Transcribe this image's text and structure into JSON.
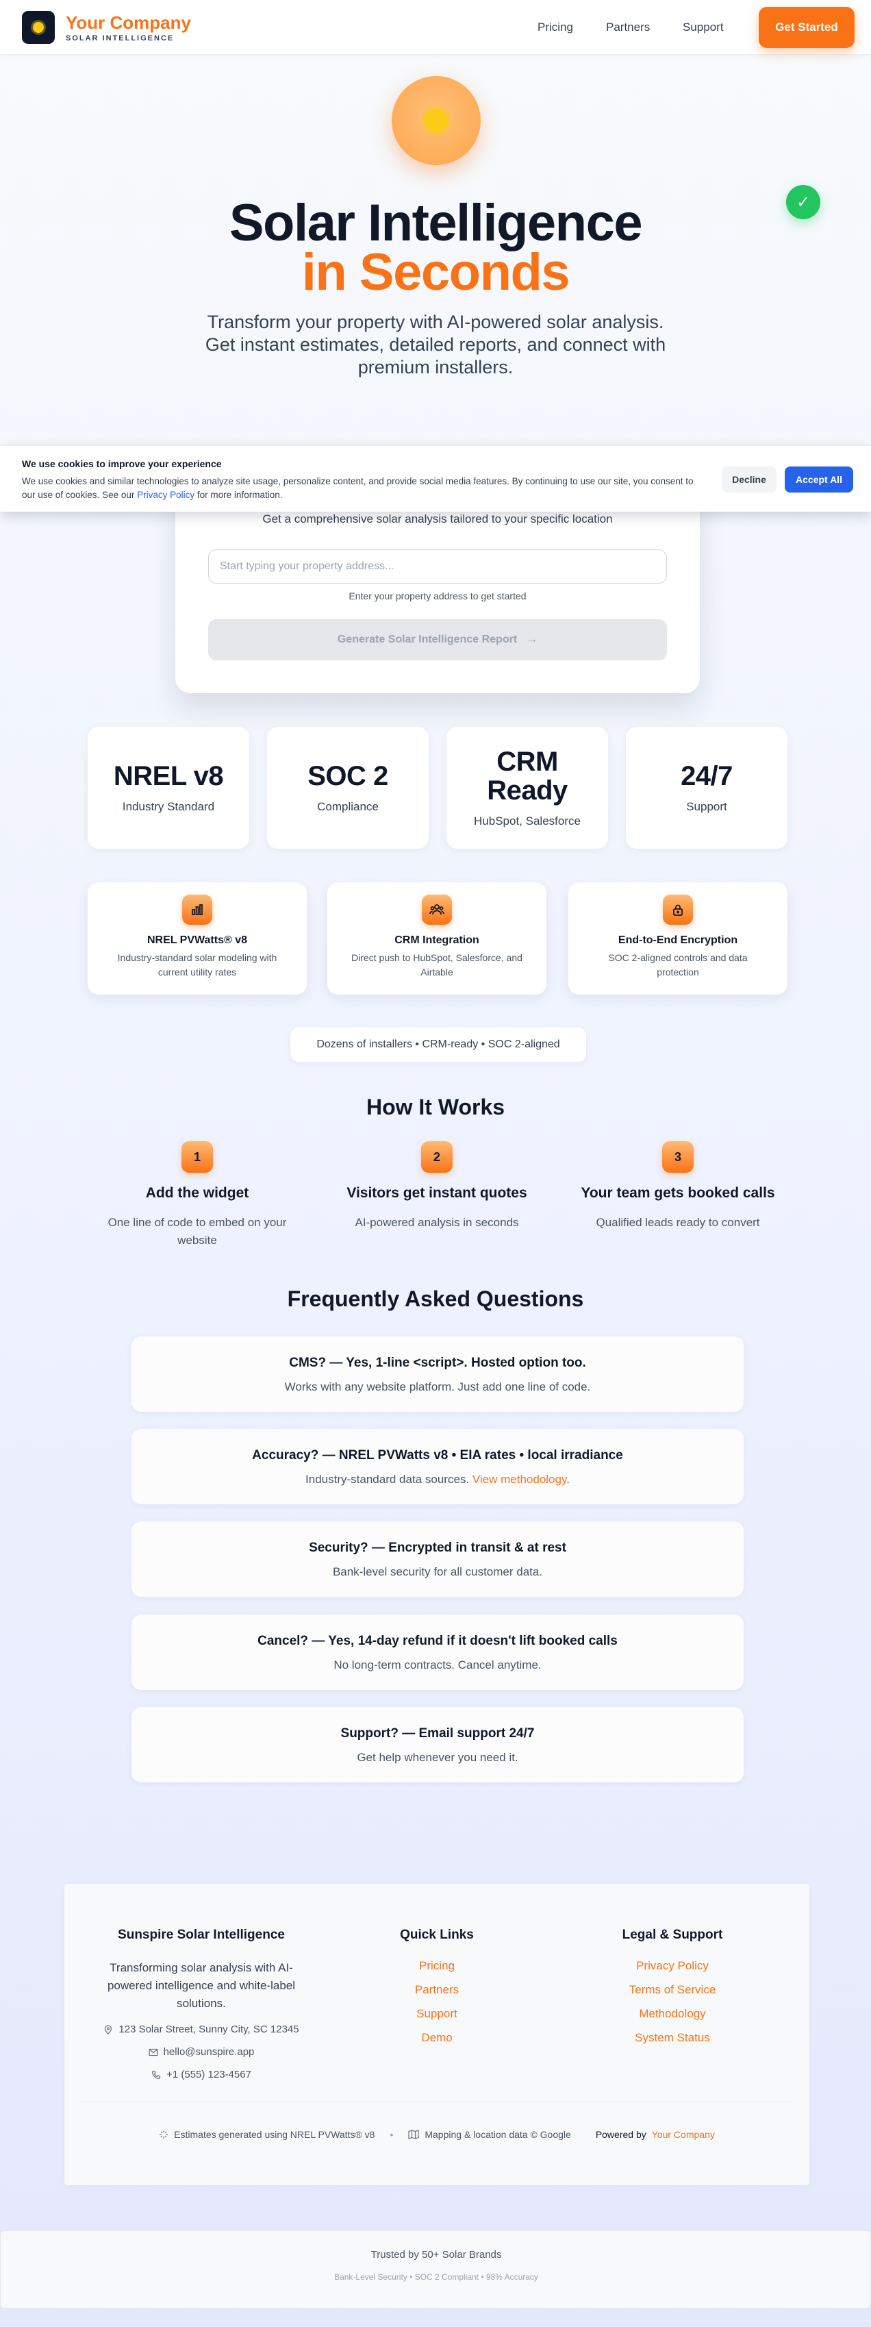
{
  "header": {
    "brand_name": "Your Company",
    "brand_tagline": "SOLAR INTELLIGENCE",
    "nav": [
      "Pricing",
      "Partners",
      "Support"
    ],
    "cta_label": "Get Started"
  },
  "hero": {
    "title_line1": "Solar Intelligence",
    "title_line2": "in Seconds",
    "subtitle": "Transform your property with AI-powered solar analysis. Get instant estimates, detailed reports, and connect with premium installers.",
    "check_icon": "✓"
  },
  "cookie": {
    "title": "We use cookies to improve your experience",
    "text": "We use cookies and similar technologies to analyze site usage, personalize content, and provide social media features. By continuing to use our site, you consent to our use of cookies. See our",
    "link": "Privacy Policy",
    "text_after": "for more information.",
    "decline": "Decline",
    "accept": "Accept All"
  },
  "form": {
    "subtitle": "Get a comprehensive solar analysis tailored to your specific location",
    "address_placeholder": "Start typing your property address...",
    "hint": "Enter your property address to get started",
    "generate_label": "Generate Solar Intelligence Report",
    "generate_arrow": "→"
  },
  "stats": [
    {
      "value": "NREL v8",
      "label": "Industry Standard"
    },
    {
      "value": "SOC 2",
      "label": "Compliance"
    },
    {
      "value": "CRM Ready",
      "label": "HubSpot, Salesforce"
    },
    {
      "value": "24/7",
      "label": "Support"
    }
  ],
  "features": [
    {
      "icon": "bar-chart-icon",
      "title": "NREL PVWatts® v8",
      "desc": "Industry-standard solar modeling with current utility rates"
    },
    {
      "icon": "team-icon",
      "title": "CRM Integration",
      "desc": "Direct push to HubSpot, Salesforce, and Airtable"
    },
    {
      "icon": "lock-icon",
      "title": "End-to-End Encryption",
      "desc": "SOC 2-aligned controls and data protection"
    }
  ],
  "pill": "Dozens of installers • CRM-ready • SOC 2-aligned",
  "how_it_works": {
    "title": "How It Works",
    "steps": [
      {
        "num": "1",
        "title": "Add the widget",
        "desc": "One line of code to embed on your website"
      },
      {
        "num": "2",
        "title": "Visitors get instant quotes",
        "desc": "AI-powered analysis in seconds"
      },
      {
        "num": "3",
        "title": "Your team gets booked calls",
        "desc": "Qualified leads ready to convert"
      }
    ]
  },
  "faq": {
    "title": "Frequently Asked Questions",
    "items": [
      {
        "q": "CMS? — Yes, 1-line <script>. Hosted option too.",
        "a": "Works with any website platform. Just add one line of code."
      },
      {
        "q": "Accuracy? — NREL PVWatts v8 • EIA rates • local irradiance",
        "a": "Industry-standard data sources.",
        "a_link": "View methodology",
        "a_end": "."
      },
      {
        "q": "Security? — Encrypted in transit & at rest",
        "a": "Bank-level security for all customer data."
      },
      {
        "q": "Cancel? — Yes, 14-day refund if it doesn't lift booked calls",
        "a": "No long-term contracts. Cancel anytime."
      },
      {
        "q": "Support? — Email support 24/7",
        "a": "Get help whenever you need it."
      }
    ]
  },
  "footer": {
    "company": "Sunspire Solar Intelligence",
    "desc": "Transforming solar analysis with AI-powered intelligence and white-label solutions.",
    "address": "123 Solar Street, Sunny City, SC 12345",
    "email": "hello@sunspire.app",
    "phone": "+1 (555) 123-4567",
    "quick_links_title": "Quick Links",
    "quick_links": [
      "Pricing",
      "Partners",
      "Support",
      "Demo"
    ],
    "legal_title": "Legal & Support",
    "legal_links": [
      "Privacy Policy",
      "Terms of Service",
      "Methodology",
      "System Status"
    ],
    "bottom_estimates": "Estimates generated using NREL PVWatts® v8",
    "bottom_sep": "•",
    "bottom_mapping": "Mapping & location data © Google",
    "bottom_powered": "Powered by",
    "bottom_powered_brand": "Your Company"
  },
  "trust": {
    "title": "Trusted by 50+ Solar Brands",
    "subtitle": "Bank-Level Security • SOC 2 Compliant • 98% Accuracy"
  },
  "colors": {
    "accent": "#f97316",
    "primary_blue": "#2563eb",
    "success": "#22c55e",
    "dark": "#0f172a"
  }
}
